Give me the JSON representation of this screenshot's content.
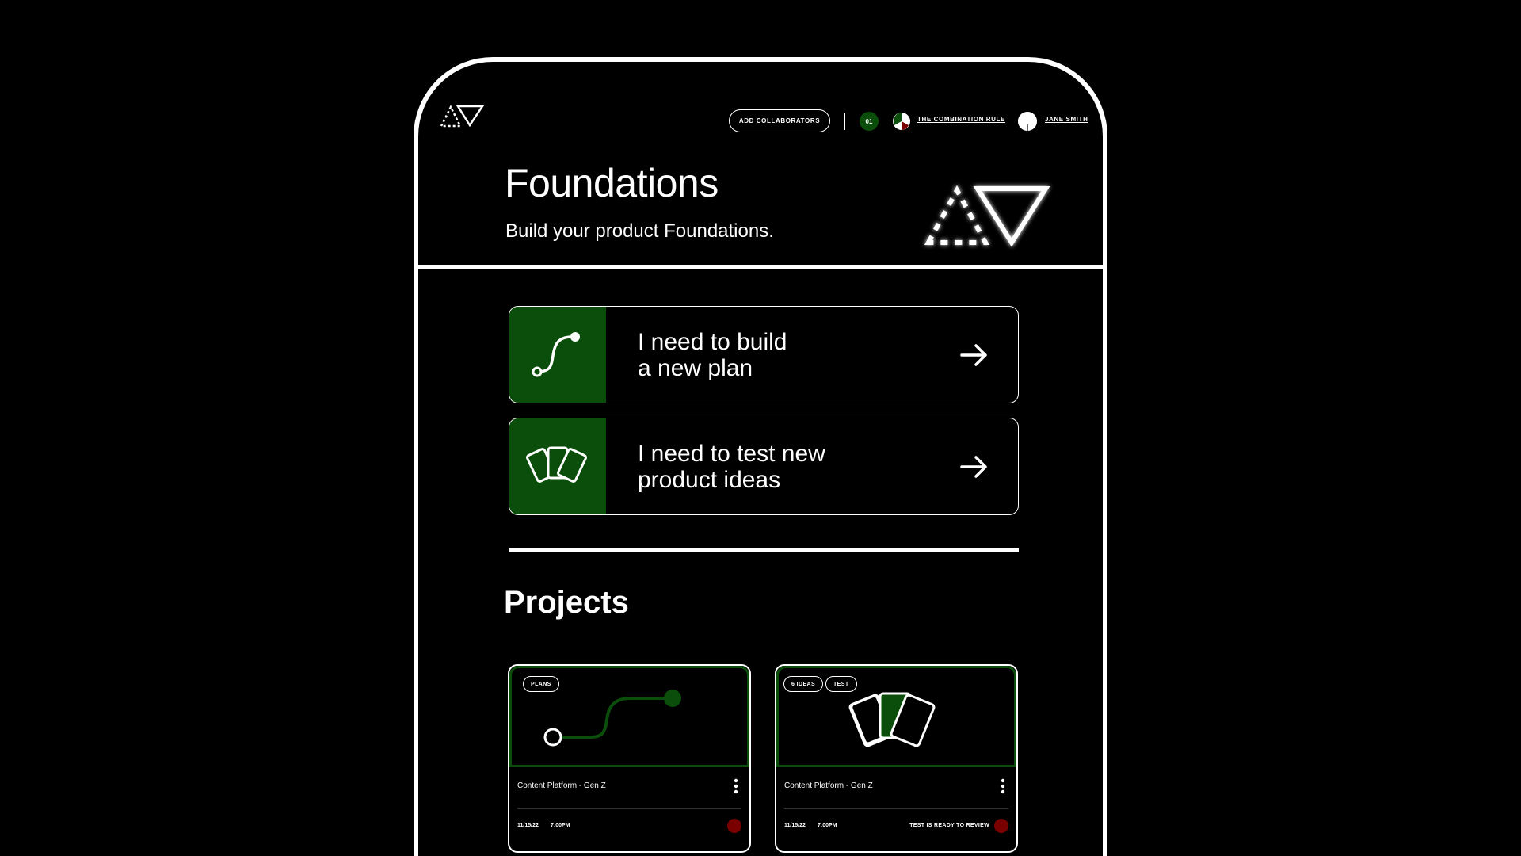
{
  "header": {
    "add_collaborators_label": "ADD COLLABORATORS",
    "count_badge": "01",
    "project_link": "THE COMBINATION RULE",
    "user_name": "JANE SMITH"
  },
  "hero": {
    "title": "Foundations",
    "subtitle": "Build your product Foundations."
  },
  "actions": [
    {
      "label": "I need to build\na new plan",
      "icon": "path-curve-icon"
    },
    {
      "label": "I need to test new\nproduct ideas",
      "icon": "cards-icon"
    }
  ],
  "projects": {
    "title": "Projects",
    "cards": [
      {
        "tags": [
          "PLANS"
        ],
        "name": "Content Platform - Gen Z",
        "date": "11/15/22",
        "time": "7:00PM",
        "status": ""
      },
      {
        "tags": [
          "6 IDEAS",
          "TEST"
        ],
        "name": "Content Platform - Gen Z",
        "date": "11/15/22",
        "time": "7:00PM",
        "status": "TEST IS READY TO REVIEW"
      }
    ]
  },
  "colors": {
    "accent_green": "#0b4d0b",
    "status_red": "#7a0000",
    "background": "#000000",
    "foreground": "#ffffff"
  }
}
